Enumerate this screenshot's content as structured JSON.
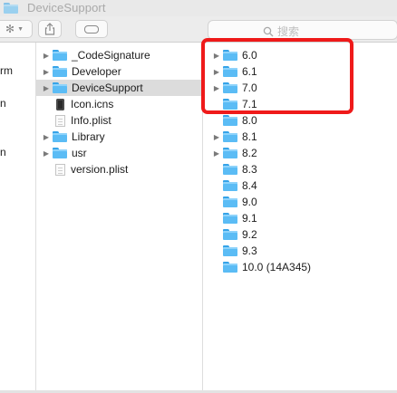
{
  "window": {
    "title": "DeviceSupport"
  },
  "toolbar": {
    "search_placeholder": "搜索"
  },
  "column0": {
    "items": [
      {
        "label": "rm"
      },
      {
        "label": ""
      },
      {
        "label": "n"
      },
      {
        "label": ""
      },
      {
        "label": ""
      },
      {
        "label": "n"
      }
    ]
  },
  "column1": {
    "items": [
      {
        "label": "_CodeSignature",
        "kind": "folder",
        "expandable": true
      },
      {
        "label": "Developer",
        "kind": "folder",
        "expandable": true
      },
      {
        "label": "DeviceSupport",
        "kind": "folder",
        "expandable": true,
        "selected": true
      },
      {
        "label": "Icon.icns",
        "kind": "icns",
        "expandable": false
      },
      {
        "label": "Info.plist",
        "kind": "document",
        "expandable": false
      },
      {
        "label": "Library",
        "kind": "folder",
        "expandable": true
      },
      {
        "label": "usr",
        "kind": "folder",
        "expandable": true
      },
      {
        "label": "version.plist",
        "kind": "document",
        "expandable": false
      }
    ]
  },
  "column2": {
    "items": [
      {
        "label": "6.0",
        "expandable": true
      },
      {
        "label": "6.1",
        "expandable": true
      },
      {
        "label": "7.0",
        "expandable": true
      },
      {
        "label": "7.1",
        "expandable": false
      },
      {
        "label": "8.0",
        "expandable": false
      },
      {
        "label": "8.1",
        "expandable": true
      },
      {
        "label": "8.2",
        "expandable": true
      },
      {
        "label": "8.3",
        "expandable": false
      },
      {
        "label": "8.4",
        "expandable": false
      },
      {
        "label": "9.0",
        "expandable": false
      },
      {
        "label": "9.1",
        "expandable": false
      },
      {
        "label": "9.2",
        "expandable": false
      },
      {
        "label": "9.3",
        "expandable": false
      },
      {
        "label": "10.0 (14A345)",
        "expandable": false
      }
    ]
  },
  "colors": {
    "folder": "#5bbcf5",
    "highlight": "#ef1a1a",
    "selection": "#dcdcdc"
  }
}
